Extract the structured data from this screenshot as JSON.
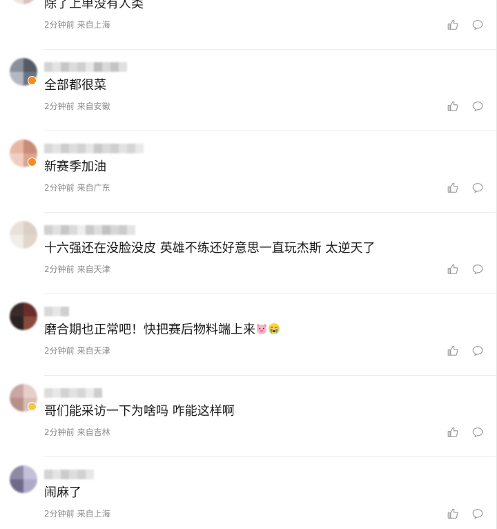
{
  "comments": [
    {
      "text": "除了上单没有人类",
      "time": "2分钟前",
      "location": "来自上海",
      "avatar_colors": [
        "#d9c7c0",
        "#c9b0a8",
        "#efe3de",
        "#d8c2ba"
      ],
      "badge_color": "",
      "name_colors": []
    },
    {
      "text": "全部都很菜",
      "time": "2分钟前",
      "location": "来自安徽",
      "avatar_colors": [
        "#8a8f9a",
        "#545a66",
        "#b3b8c2",
        "#6d7280"
      ],
      "badge_color": "#f58a1f",
      "name_colors": [
        "#d4d4d4",
        "#e3e3e3",
        "#c6c6c6",
        "#dcdcdc",
        "#cfcfcf",
        "#e8e8e8",
        "#bdbdbd",
        "#d9d9d9",
        "#c4c4c4",
        "#e0e0e0"
      ]
    },
    {
      "text": "新赛季加油",
      "time": "2分钟前",
      "location": "来自广东",
      "avatar_colors": [
        "#e8b8a4",
        "#c98c78",
        "#f0cfc0",
        "#d7a591"
      ],
      "badge_color": "#f58a1f",
      "name_colors": [
        "#d8d8d8",
        "#e4e4e4",
        "#cdcdcd",
        "#dddddd",
        "#d2d2d2",
        "#e6e6e6",
        "#c9c9c9",
        "#dadada",
        "#cfcfcf",
        "#e2e2e2",
        "#d5d5d5",
        "#e9e9e9"
      ]
    },
    {
      "text": "十六强还在没脸没皮 英雄不练还好意思一直玩杰斯 太逆天了",
      "time": "2分钟前",
      "location": "来自天津",
      "avatar_colors": [
        "#e9e1d8",
        "#d9cfc4",
        "#f2ede7",
        "#e0d6cb"
      ],
      "badge_color": "",
      "name_colors": [
        "#d0d0d0",
        "#e0e0e0",
        "#c7c7c7",
        "#dadada",
        "#eeeeee",
        "#cacaca",
        "#dedede",
        "#c2c2c2",
        "#d6d6d6",
        "#cccccc",
        "#e3e3e3"
      ]
    },
    {
      "text": "磨合期也正常吧！快把赛后物料端上来",
      "emoji": [
        "pig-face",
        "crying-face"
      ],
      "time": "2分钟前",
      "location": "来自天津",
      "avatar_colors": [
        "#3b2a2a",
        "#6b2c2c",
        "#2a2222",
        "#8a4a3a"
      ],
      "badge_color": "",
      "name_colors": [
        "#d8d8d8",
        "#e6e6e6",
        "#cfcfcf"
      ]
    },
    {
      "text": "哥们能采访一下为啥吗 咋能这样啊",
      "time": "2分钟前",
      "location": "来自吉林",
      "avatar_colors": [
        "#caa7a3",
        "#e6cfc8",
        "#b8908a",
        "#d9bdb6"
      ],
      "badge_color": "#f5c842",
      "name_colors": [
        "#dcdcdc",
        "#e8e8e8",
        "#d2d2d2",
        "#e2e2e2",
        "#d6d6d6",
        "#ececec",
        "#cecece"
      ]
    },
    {
      "text": "闹麻了",
      "time": "2分钟前",
      "location": "来自上海",
      "avatar_colors": [
        "#8f8aa8",
        "#c5c0d8",
        "#6f6a8a",
        "#b0aac6"
      ],
      "badge_color": "",
      "name_colors": [
        "#d4d4d4",
        "#e4e4e4",
        "#cbcbcb",
        "#dddddd",
        "#d1d1d1",
        "#e6e6e6"
      ]
    }
  ],
  "icons": {
    "like": "thumbs-up-icon",
    "reply": "comment-bubble-icon"
  },
  "colors": {
    "text": "#1a1a1a",
    "meta": "#8a8a8a",
    "icon": "#9a9a9a",
    "divider": "#ececec"
  }
}
